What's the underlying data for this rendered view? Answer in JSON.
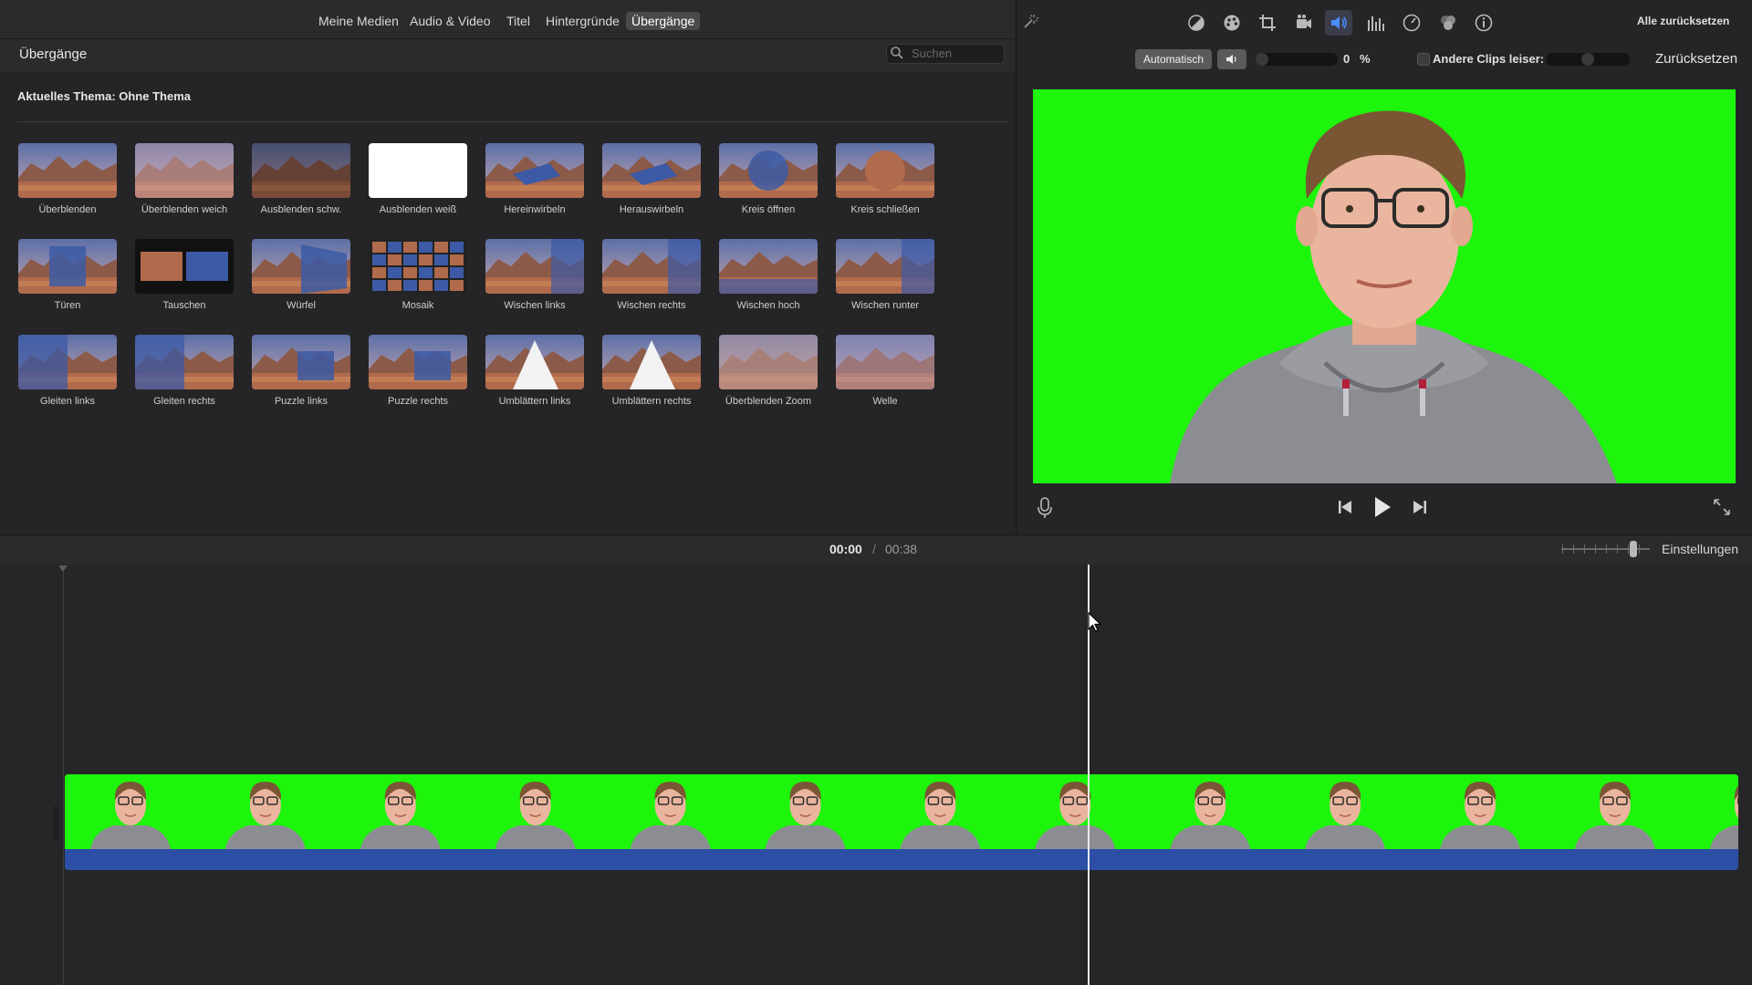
{
  "media_tabs": [
    {
      "label": "Meine Medien"
    },
    {
      "label": "Audio & Video"
    },
    {
      "label": "Titel"
    },
    {
      "label": "Hintergründe"
    },
    {
      "label": "Übergänge",
      "active": true
    }
  ],
  "browser": {
    "title": "Übergänge",
    "search_placeholder": "Suchen",
    "theme_label": "Aktuelles Thema: Ohne Thema"
  },
  "transitions": [
    {
      "label": "Überblenden",
      "icon": "mountain-lake"
    },
    {
      "label": "Überblenden weich",
      "icon": "mountain-lake-soft"
    },
    {
      "label": "Ausblenden schw.",
      "icon": "mountain-lake-dark"
    },
    {
      "label": "Ausblenden weiß",
      "icon": "white-fade"
    },
    {
      "label": "Hereinwirbeln",
      "icon": "swirl-in"
    },
    {
      "label": "Herauswirbeln",
      "icon": "swirl-out"
    },
    {
      "label": "Kreis öffnen",
      "icon": "circle-open"
    },
    {
      "label": "Kreis schließen",
      "icon": "circle-close"
    },
    {
      "label": "Türen",
      "icon": "doors"
    },
    {
      "label": "Tauschen",
      "icon": "swap"
    },
    {
      "label": "Würfel",
      "icon": "cube"
    },
    {
      "label": "Mosaik",
      "icon": "mosaic"
    },
    {
      "label": "Wischen links",
      "icon": "wipe-left"
    },
    {
      "label": "Wischen rechts",
      "icon": "wipe-right"
    },
    {
      "label": "Wischen hoch",
      "icon": "wipe-up"
    },
    {
      "label": "Wischen runter",
      "icon": "wipe-down"
    },
    {
      "label": "Gleiten links",
      "icon": "slide-left"
    },
    {
      "label": "Gleiten rechts",
      "icon": "slide-right"
    },
    {
      "label": "Puzzle links",
      "icon": "puzzle-left"
    },
    {
      "label": "Puzzle rechts",
      "icon": "puzzle-right"
    },
    {
      "label": "Umblättern links",
      "icon": "page-curl-left"
    },
    {
      "label": "Umblättern rechts",
      "icon": "page-curl-right"
    },
    {
      "label": "Überblenden Zoom",
      "icon": "zoom-blur"
    },
    {
      "label": "Welle",
      "icon": "ripple"
    }
  ],
  "viewer": {
    "reset_all_label": "Alle zurücksetzen",
    "auto_label": "Automatisch",
    "volume_value": "0",
    "volume_unit": "%",
    "volume_level": 0,
    "other_clips_label": "Andere Clips leiser:",
    "other_clips_level": 0.5,
    "reset_label": "Zurücksetzen",
    "toolbar_icons": [
      "magic-wand-icon",
      "color-balance-icon",
      "color-correction-icon",
      "crop-icon",
      "stabilization-icon",
      "volume-icon",
      "equalizer-icon",
      "speed-icon",
      "noise-reduction-icon",
      "info-icon"
    ]
  },
  "timeline": {
    "current_time": "00:00",
    "separator": "/",
    "total_time": "00:38",
    "settings_label": "Einstellungen",
    "zoom_level": 0.75,
    "clip_frame_count": 13
  },
  "colors": {
    "green_screen": "#1df50c",
    "audio_track": "#2c4ea5",
    "active_icon": "#4a8cff"
  }
}
